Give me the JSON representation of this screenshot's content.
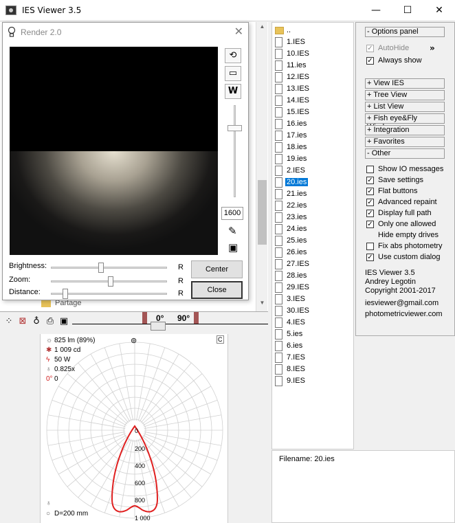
{
  "window": {
    "title": "IES Viewer 3.5",
    "minimize": "—",
    "maximize": "☐",
    "close": "✕"
  },
  "tree": {
    "partage_label": "Partage"
  },
  "render": {
    "title": "Render 2.0",
    "close": "✕",
    "zoom_value": "1600",
    "brightness_label": "Brightness:",
    "zoom_label": "Zoom:",
    "distance_label": "Distance:",
    "reset_label": "R",
    "center_button": "Center",
    "close_button": "Close",
    "brightness_level": 0.42,
    "zoom_level": 0.51,
    "distance_level": 0.1
  },
  "angles": {
    "a0": "0°",
    "a90": "90°"
  },
  "photometry": {
    "flux": "825 lm (89%)",
    "intensity": "1 009 cd",
    "power": "50 W",
    "factor": "0.825x",
    "angle": "0",
    "diameter": "D=200 mm",
    "rings": [
      "0",
      "200",
      "400",
      "600",
      "800",
      "1 000"
    ]
  },
  "files": {
    "items": [
      "..",
      "1.IES",
      "10.IES",
      "11.ies",
      "12.IES",
      "13.IES",
      "14.IES",
      "15.IES",
      "16.ies",
      "17.ies",
      "18.ies",
      "19.ies",
      "2.IES",
      "20.ies",
      "21.ies",
      "22.ies",
      "23.ies",
      "24.ies",
      "25.ies",
      "26.ies",
      "27.IES",
      "28.ies",
      "29.IES",
      "3.IES",
      "30.IES",
      "4.IES",
      "5.ies",
      "6.ies",
      "7.IES",
      "8.IES",
      "9.IES"
    ],
    "selected": "20.ies",
    "filename_text": "Filename: 20.ies"
  },
  "options": {
    "options_panel": "- Options panel",
    "autohide": "AutoHide",
    "always_show": "Always show",
    "sections": [
      "+ View IES",
      "+ Tree View",
      "+ List View",
      "+ Fish eye&Fly Window",
      "+ Integration",
      "+ Favorites",
      "- Other"
    ],
    "other_items": [
      {
        "label": "Show IO messages",
        "checked": false
      },
      {
        "label": "Save settings",
        "checked": true
      },
      {
        "label": "Flat buttons",
        "checked": true
      },
      {
        "label": "Advanced repaint",
        "checked": true
      },
      {
        "label": "Display full path",
        "checked": true
      },
      {
        "label": "Only one allowed",
        "checked": true
      },
      {
        "label": "Hide empty drives",
        "checked": null
      },
      {
        "label": "Fix abs photometry",
        "checked": false
      },
      {
        "label": "Use custom dialog",
        "checked": true
      }
    ],
    "about": [
      "IES Viewer 3.5",
      "Andrey Legotin",
      "Copyright 2001-2017",
      "iesviewer@gmail.com",
      "photometricviewer.com"
    ]
  }
}
